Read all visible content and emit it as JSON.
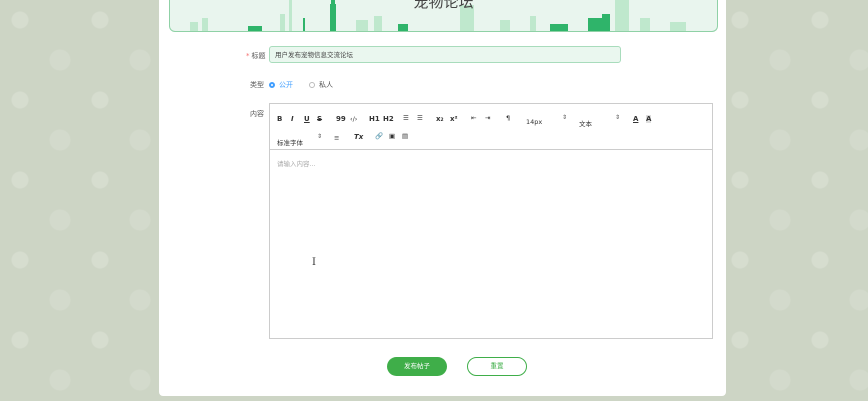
{
  "banner": {
    "title": "宠物论坛"
  },
  "form": {
    "title_label": "标题",
    "title_required": "*",
    "title_value": "用户发布宠物信息交流论坛",
    "type_label": "类型",
    "type_options": [
      {
        "label": "公开",
        "selected": true
      },
      {
        "label": "私人",
        "selected": false
      }
    ],
    "content_label": "内容"
  },
  "editor": {
    "toolbar": {
      "bold": "B",
      "italic": "I",
      "underline": "U",
      "strike": "S",
      "blockquote": "99",
      "code": "‹/›",
      "h1": "H1",
      "h2": "H2",
      "ordered_list": "☰",
      "bullet_list": "☰",
      "subscript": "x₂",
      "superscript": "x²",
      "indent_decrease": "⇤",
      "indent_increase": "⇥",
      "direction": "¶",
      "size_value": "14px",
      "header_value": "文本",
      "font_color": "A",
      "background_color": "A",
      "font_value": "标准字体",
      "align": "≡",
      "clean": "Tx",
      "link": "🔗",
      "image": "▣",
      "video": "▤"
    },
    "placeholder": "请输入内容..."
  },
  "actions": {
    "submit_label": "发布帖子",
    "reset_label": "重置"
  },
  "colors": {
    "primary": "#3fae49",
    "radio_active": "#409eff",
    "banner_bg": "#e9f5ee"
  }
}
